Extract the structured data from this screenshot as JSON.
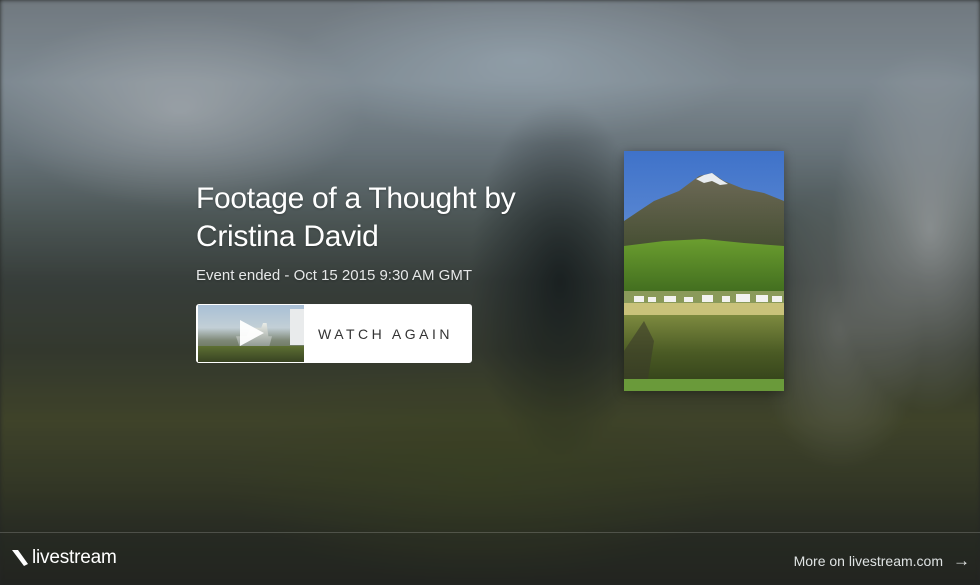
{
  "event": {
    "title": "Footage of a Thought by Cristina David",
    "status": "Event ended - Oct 15 2015 9:30 AM GMT"
  },
  "watch": {
    "label": "WATCH AGAIN",
    "thumbnail_icon": "play-icon"
  },
  "footer": {
    "brand": "livestream",
    "more_link": "More on livestream.com",
    "arrow": "→"
  }
}
